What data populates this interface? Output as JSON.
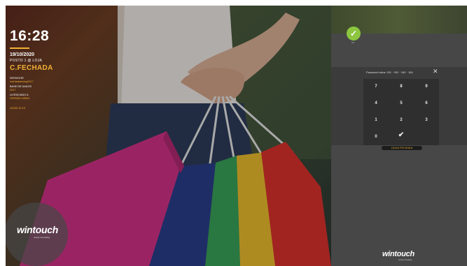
{
  "clock": {
    "time": "16:28",
    "date": "19/10/2020",
    "posto": "POSTO 1 @ LOJA",
    "status": "C.FECHADA"
  },
  "meta": [
    {
      "label": "SERVIDOR",
      "value": "wnt.fastserving2017"
    },
    {
      "label": "BASE DE DADOS",
      "value": "2017"
    },
    {
      "label": "LICENCIADO A",
      "value": "VERSÃO DEMO"
    }
  ],
  "version": "v2020.10.19",
  "brand": {
    "name": "wintouch",
    "tagline": "simply innovating"
  },
  "panel": {
    "check_label": "OK",
    "pad_label": "Password ativa: 001 · 002 · 160 · 184",
    "close_symbol": "✕",
    "keys": [
      "7",
      "8",
      "9",
      "4",
      "5",
      "6",
      "1",
      "2",
      "3",
      "0",
      "",
      "✔"
    ],
    "button_label": "CAIXA FECHADA"
  },
  "colors": {
    "accent": "#f2b035",
    "success": "#8cc63f",
    "panel": "#474747"
  }
}
